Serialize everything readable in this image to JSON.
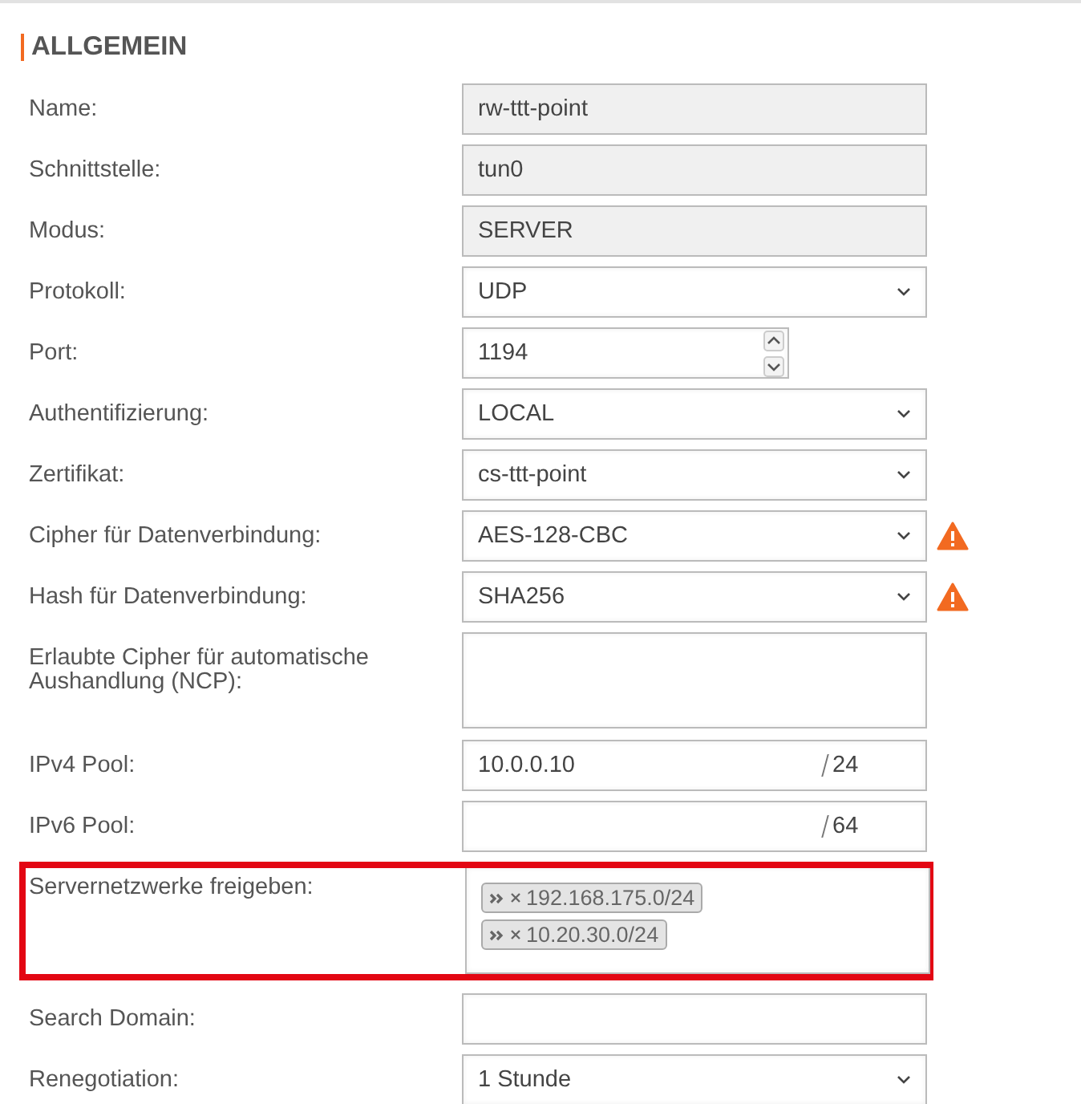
{
  "section": {
    "title": "ALLGEMEIN"
  },
  "fields": [
    {
      "label": "Name:",
      "kind": "readonly",
      "value": "rw-ttt-point"
    },
    {
      "label": "Schnittstelle:",
      "kind": "readonly",
      "value": "tun0"
    },
    {
      "label": "Modus:",
      "kind": "readonly",
      "value": "SERVER"
    },
    {
      "label": "Protokoll:",
      "kind": "select",
      "value": "UDP"
    },
    {
      "label": "Port:",
      "kind": "spinner",
      "value": "1194"
    },
    {
      "label": "Authentifizierung:",
      "kind": "select",
      "value": "LOCAL"
    },
    {
      "label": "Zertifikat:",
      "kind": "select",
      "value": "cs-ttt-point"
    },
    {
      "label": "Cipher für Datenverbindung:",
      "kind": "select",
      "value": "AES-128-CBC",
      "warning": true
    },
    {
      "label": "Hash für Datenverbindung:",
      "kind": "select",
      "value": "SHA256",
      "warning": true
    },
    {
      "label": "Erlaubte Cipher für automatische Aushandlung (NCP):",
      "kind": "textarea"
    },
    {
      "label": "IPv4 Pool:",
      "kind": "pool",
      "value": "10.0.0.10",
      "suffix": "24"
    },
    {
      "label": "IPv6 Pool:",
      "kind": "pool",
      "suffix": "64"
    },
    {
      "label": "Servernetzwerke freigeben:",
      "kind": "tags",
      "highlighted": true,
      "tags": [
        "192.168.175.0/24",
        "10.20.30.0/24"
      ]
    },
    {
      "label": "Search Domain:",
      "kind": "text"
    },
    {
      "label": "Renegotiation:",
      "kind": "select",
      "value": "1 Stunde"
    }
  ]
}
